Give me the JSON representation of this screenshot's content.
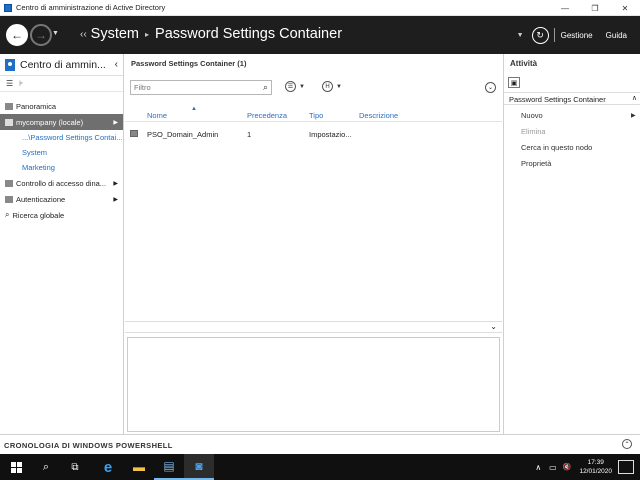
{
  "window": {
    "title": "Centro di amministrazione di Active Directory",
    "minimize_icon": "—",
    "restore_icon": "❐",
    "close_icon": "✕"
  },
  "header": {
    "back_icon": "←",
    "forward_icon": "→",
    "history_icon": "▼",
    "breadcrumb_prefix": "‹‹",
    "breadcrumb": [
      "System",
      "Password Settings Container"
    ],
    "breadcrumb_sep": "▸",
    "refresh_icon": "↻",
    "manage_label": "Gestione",
    "help_label": "Guida"
  },
  "leftnav": {
    "title": "Centro di ammin...",
    "collapse_icon": "‹",
    "list_view_icon": "☰",
    "tree_view_icon": "⊧",
    "items": [
      {
        "label": "Panoramica",
        "icon": "overview-icon"
      },
      {
        "label": "mycompany (locale)",
        "icon": "domain-icon",
        "selected": true
      },
      {
        "label": "...\\Password Settings Contai...",
        "sub": true
      },
      {
        "label": "System",
        "sub": true
      },
      {
        "label": "Marketing",
        "sub": true
      },
      {
        "label": "Controllo di accesso dina...",
        "icon": "access-control-icon",
        "arrow": true
      },
      {
        "label": "Autenticazione",
        "icon": "authentication-icon",
        "arrow": true
      },
      {
        "label": "Ricerca globale",
        "icon": "search-icon"
      }
    ],
    "arrow_glyph": "▶",
    "search_glyph": "⌕"
  },
  "center": {
    "title": "Password Settings Container  (1)",
    "filter_placeholder": "Filtro",
    "filter_icon": "⌕",
    "view_btn_icon": "☰",
    "group_btn_icon": "H",
    "dropdown_icon": "▼",
    "expand_icon": "⌄",
    "columns": [
      "Nome",
      "Precedenza",
      "Tipo",
      "Descrizione"
    ],
    "sort_icon": "▲",
    "rows": [
      {
        "name": "PSO_Domain_Admin",
        "precedence": "1",
        "type": "Impostazio...",
        "description": ""
      }
    ],
    "split_chevron": "⌄"
  },
  "tasks": {
    "title": "Attività",
    "clipboard_icon": "📋",
    "section": "Password Settings Container",
    "section_chevron": "∧",
    "items": [
      {
        "label": "Nuovo",
        "enabled": true,
        "submenu": true
      },
      {
        "label": "Elimina",
        "enabled": false
      },
      {
        "label": "Cerca in questo nodo",
        "enabled": true
      },
      {
        "label": "Proprietà",
        "enabled": true
      }
    ],
    "submenu_arrow": "▶"
  },
  "powershell": {
    "label": "CRONOLOGIA DI WINDOWS POWERSHELL",
    "expand_icon": "⌃"
  },
  "taskbar": {
    "search_icon": "⌕",
    "taskview_icon": "⧉",
    "edge_icon": "e",
    "explorer_icon": "▬",
    "server_icon": "▤",
    "ad_icon": "◙",
    "tray_chevron": "∧",
    "network_icon": "▭",
    "volume_icon": "🔇",
    "time": "17:39",
    "date": "12/01/2020",
    "notification_icon": "▢"
  },
  "colors": {
    "header_bg": "#1e1e1e",
    "selected_bg": "#6f6f6f",
    "link": "#1f6fc5",
    "taskbar_bg": "#101010"
  }
}
